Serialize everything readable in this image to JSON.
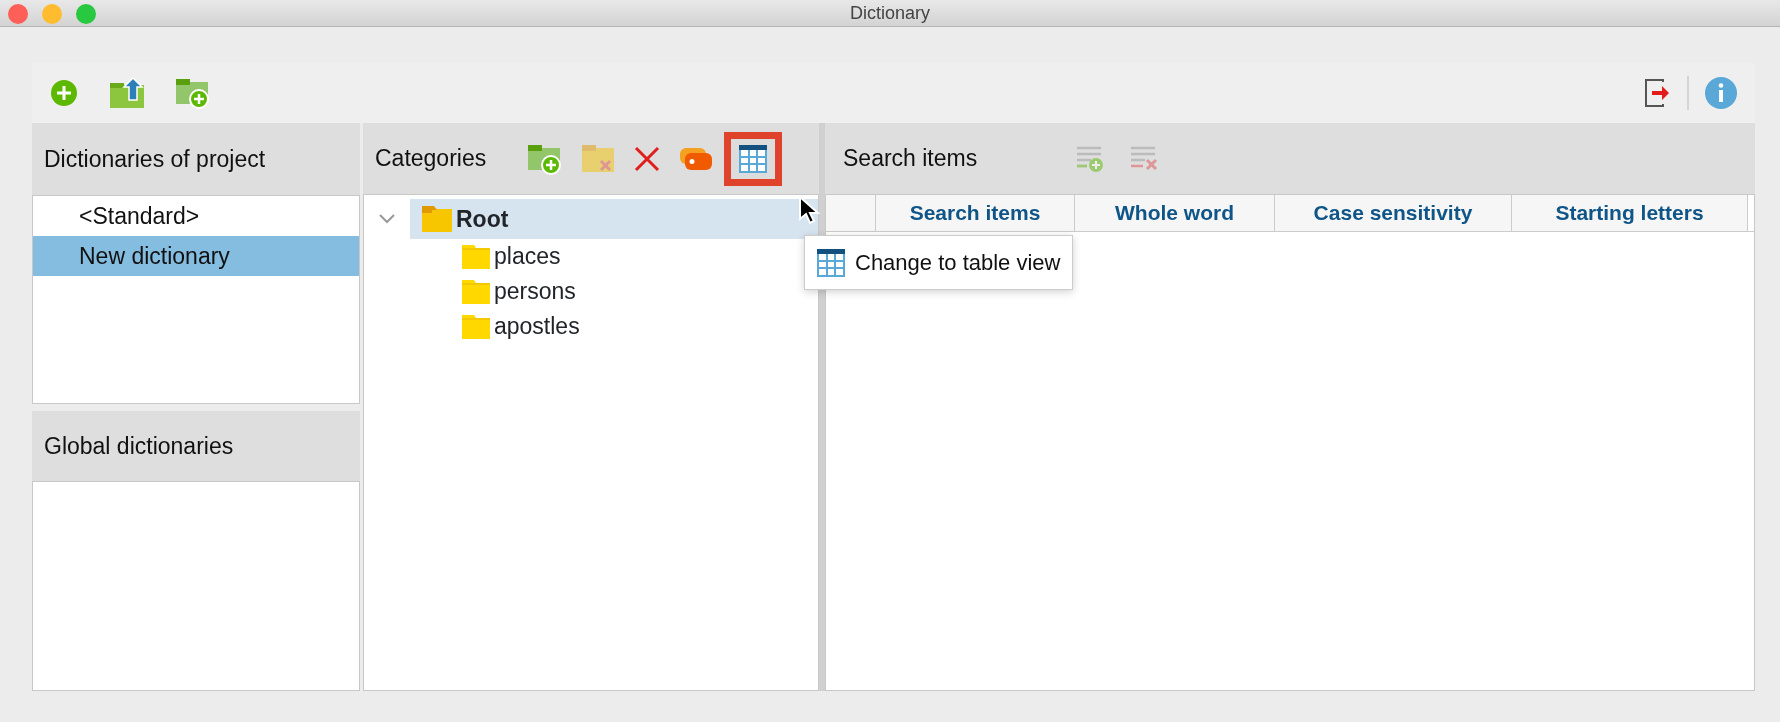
{
  "window": {
    "title": "Dictionary"
  },
  "main_toolbar": {
    "left": [
      {
        "kind": "add",
        "disabled": false
      },
      {
        "kind": "folder-up",
        "disabled": false
      },
      {
        "kind": "folder-add",
        "disabled": false
      }
    ],
    "right": [
      {
        "kind": "exit",
        "disabled": false
      },
      {
        "kind": "info",
        "disabled": false
      }
    ]
  },
  "dictionaries_panel": {
    "title": "Dictionaries of project",
    "items": [
      {
        "label": "<Standard>",
        "selected": false
      },
      {
        "label": "New dictionary",
        "selected": true
      }
    ]
  },
  "global_panel": {
    "title": "Global dictionaries"
  },
  "categories_panel": {
    "title": "Categories",
    "buttons": [
      {
        "kind": "folder-add",
        "disabled": false,
        "highlighted": false
      },
      {
        "kind": "folder-delete",
        "disabled": true,
        "highlighted": false
      },
      {
        "kind": "delete",
        "disabled": false,
        "highlighted": false
      },
      {
        "kind": "tag",
        "disabled": false,
        "highlighted": false
      },
      {
        "kind": "table",
        "disabled": false,
        "highlighted": true
      }
    ],
    "tree": [
      {
        "label": "Root",
        "expanded": true,
        "selected": true,
        "children": [
          {
            "label": "places",
            "selected": false
          },
          {
            "label": "persons",
            "selected": false
          },
          {
            "label": "apostles",
            "selected": false
          }
        ]
      }
    ]
  },
  "search_panel": {
    "title": "Search items",
    "buttons": [
      {
        "kind": "list-add",
        "disabled": true
      },
      {
        "kind": "list-delete",
        "disabled": true
      }
    ],
    "columns": [
      "Search items",
      "Whole word",
      "Case sensitivity",
      "Starting letters"
    ]
  },
  "tooltip": {
    "text": "Change to table view"
  }
}
